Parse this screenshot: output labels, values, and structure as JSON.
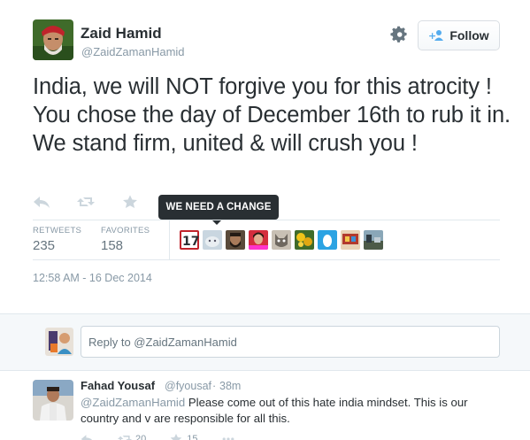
{
  "author": {
    "name": "Zaid Hamid",
    "handle": "@ZaidZamanHamid"
  },
  "follow_label": "Follow",
  "tweet_text": "India, we will NOT forgive you for this atrocity ! You chose the day of December 16th to rub it in. We stand firm, united & will crush you !",
  "tooltip": "WE NEED A CHANGE",
  "stats": {
    "retweets_label": "RETWEETS",
    "retweets": "235",
    "favorites_label": "FAVORITES",
    "favorites": "158"
  },
  "favoriter_avatars": [
    "17-badge-avatar",
    "cat-photo-avatar",
    "bearded-man-avatar",
    "woman-red-avatar",
    "grey-cat-avatar",
    "yellow-flowers-avatar",
    "egg-avatar",
    "colorful-avatar",
    "landscape-avatar"
  ],
  "timestamp": "12:58 AM - 16 Dec 2014",
  "reply_box": {
    "placeholder": "Reply to @ZaidZamanHamid"
  },
  "reply": {
    "name": "Fahad Yousaf",
    "handle": "@fyousaf",
    "time": "38m",
    "mention": "@ZaidZamanHamid",
    "text": " Please come out of this hate india mindset. This is our country and v are responsible for all this.",
    "retweets": "20",
    "favorites": "15"
  },
  "colors": {
    "text": "#292f33",
    "muted": "#8899a6",
    "stat_value": "#66757f",
    "tooltip_bg": "#292f33",
    "reply_bg": "#f5f8fa"
  },
  "icons": {
    "reply": "reply-icon",
    "retweet": "retweet-icon",
    "favorite": "star-icon",
    "more": "more-icon",
    "settings": "gear-icon",
    "follow": "add-user-icon"
  }
}
